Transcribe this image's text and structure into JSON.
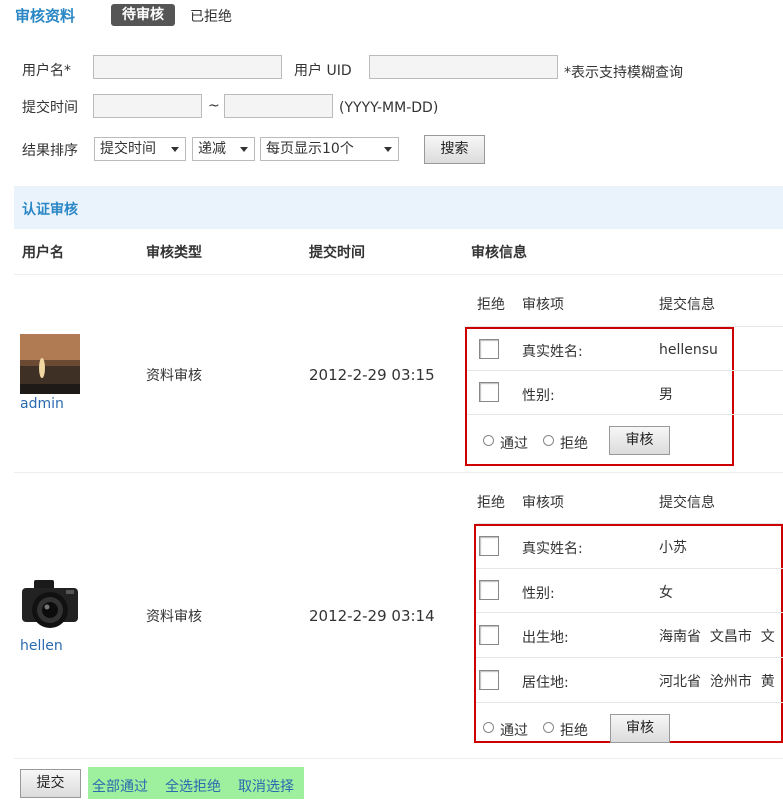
{
  "header": {
    "title": "审核资料",
    "tabs": [
      {
        "label": "待审核",
        "active": true
      },
      {
        "label": "已拒绝",
        "active": false
      }
    ]
  },
  "search": {
    "username_label": "用户名*",
    "username_value": "",
    "uid_label": "用户 UID",
    "uid_value": "",
    "fuzzy_note": "*表示支持模糊查询",
    "time_label": "提交时间",
    "time_from": "",
    "time_sep": "~",
    "time_to": "",
    "time_format": "(YYYY-MM-DD)",
    "sort_label": "结果排序",
    "sort_field": "提交时间",
    "sort_order": "递减",
    "page_size": "每页显示10个",
    "search_button": "搜索"
  },
  "section": {
    "title": "认证审核"
  },
  "table": {
    "columns": [
      "用户名",
      "审核类型",
      "提交时间",
      "审核信息"
    ],
    "sub_columns": [
      "拒绝",
      "审核项",
      "提交信息"
    ],
    "rows": [
      {
        "username": "admin",
        "type": "资料审核",
        "time": "2012-2-29 03:15",
        "items": [
          {
            "field": "真实姓名:",
            "value": "hellensu"
          },
          {
            "field": "性别:",
            "value": "男"
          }
        ],
        "pass_label": "通过",
        "reject_label": "拒绝",
        "review_button": "审核"
      },
      {
        "username": "hellen",
        "type": "资料审核",
        "time": "2012-2-29 03:14",
        "items": [
          {
            "field": "真实姓名:",
            "value": "小苏"
          },
          {
            "field": "性别:",
            "value": "女"
          },
          {
            "field": "出生地:",
            "value": "海南省  文昌市  文"
          },
          {
            "field": "居住地:",
            "value": "河北省  沧州市  黄"
          }
        ],
        "pass_label": "通过",
        "reject_label": "拒绝",
        "review_button": "审核"
      }
    ]
  },
  "footer": {
    "submit_button": "提交",
    "all_pass": "全部通过",
    "all_reject": "全选拒绝",
    "cancel_select": "取消选择"
  },
  "colors": {
    "accent": "#2a87c5",
    "highlight_box": "#cc0000",
    "green_bar": "#9ef09e",
    "section_bg": "#eaf3fb"
  }
}
